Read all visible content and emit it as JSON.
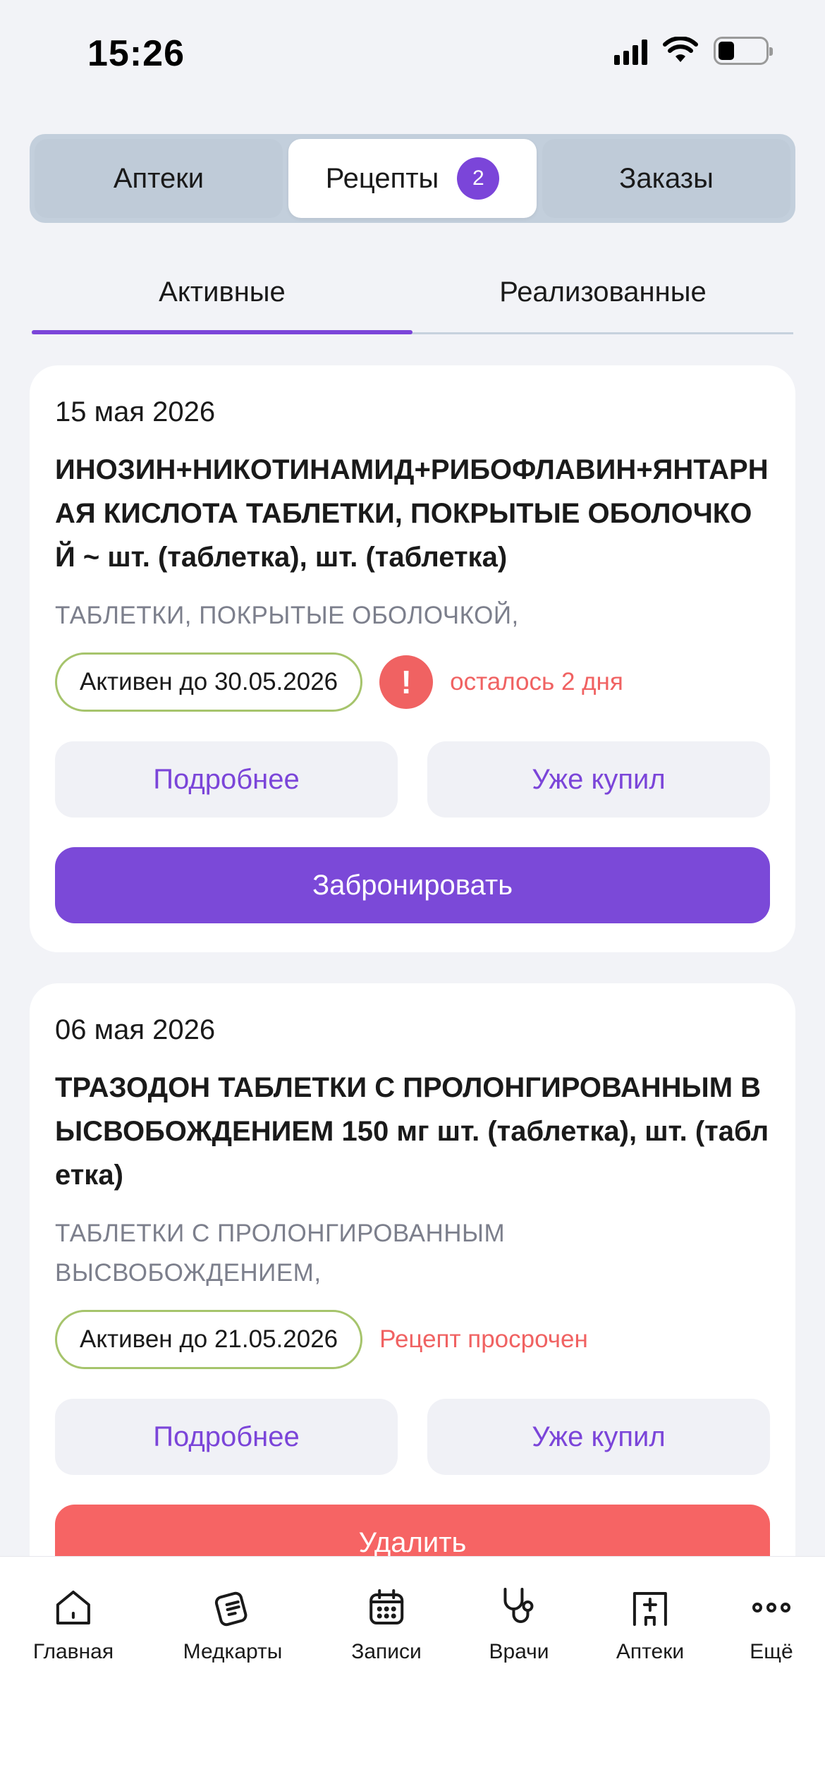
{
  "status_bar": {
    "time": "15:26"
  },
  "segments": [
    {
      "label": "Аптеки"
    },
    {
      "label": "Рецепты",
      "badge": "2"
    },
    {
      "label": "Заказы"
    }
  ],
  "subtabs": [
    {
      "label": "Активные"
    },
    {
      "label": "Реализованные"
    }
  ],
  "prescriptions": [
    {
      "date": "15 мая 2026",
      "title": "ИНОЗИН+НИКОТИНАМИД+РИБОФЛАВИН+ЯНТАРНАЯ КИСЛОТА ТАБЛЕТКИ, ПОКРЫТЫЕ ОБОЛОЧКОЙ ~ шт. (таблетка), шт. (таблетка)",
      "form": "ТАБЛЕТКИ, ПОКРЫТЫЕ ОБОЛОЧКОЙ,",
      "status": "Активен до 30.05.2026",
      "alert_icon": "!",
      "alert": "осталось 2 дня",
      "details_label": "Подробнее",
      "bought_label": "Уже купил",
      "action_label": "Забронировать"
    },
    {
      "date": "06 мая 2026",
      "title": "ТРАЗОДОН ТАБЛЕТКИ С ПРОЛОНГИРОВАННЫМ ВЫСВОБОЖДЕНИЕМ 150 мг шт. (таблетка), шт. (таблетка)",
      "form": "ТАБЛЕТКИ С ПРОЛОНГИРОВАННЫМ ВЫСВОБОЖДЕНИЕМ,",
      "status": "Активен до 21.05.2026",
      "alert": "Рецепт просрочен",
      "details_label": "Подробнее",
      "bought_label": "Уже купил",
      "action_label": "Удалить"
    }
  ],
  "bottom_nav": [
    {
      "label": "Главная",
      "icon": "home-icon"
    },
    {
      "label": "Медкарты",
      "icon": "medcard-icon"
    },
    {
      "label": "Записи",
      "icon": "calendar-icon"
    },
    {
      "label": "Врачи",
      "icon": "stethoscope-icon"
    },
    {
      "label": "Аптеки",
      "icon": "pharmacy-icon"
    },
    {
      "label": "Ещё",
      "icon": "more-icon"
    }
  ],
  "colors": {
    "accent": "#7b45d9",
    "danger": "#f06262",
    "pill_border": "#a6c46c",
    "background": "#f2f3f7"
  }
}
